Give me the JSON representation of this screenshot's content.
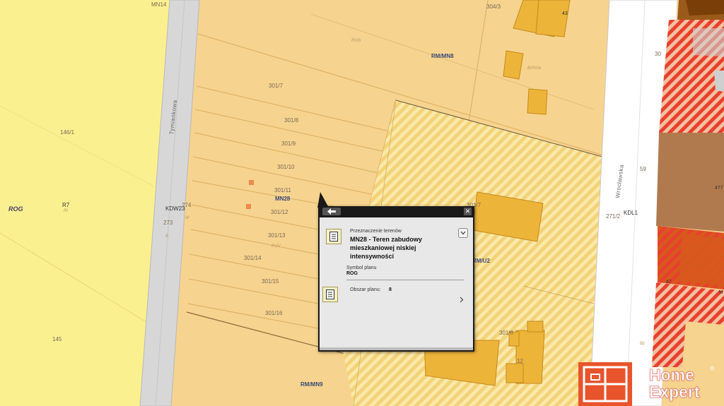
{
  "map": {
    "labels": {
      "mn14": "MN14",
      "p304_3": "304/3",
      "rmmn8": "RM/MN8",
      "rivb": "RIVb",
      "brriva": "BrRIVa",
      "p301_7": "301/7",
      "p301_8": "301/8",
      "p301_9": "301/9",
      "p301_10": "301/10",
      "p301_11": "301/11",
      "mn28": "MN28",
      "p301_12": "301/12",
      "p301_13": "301/13",
      "psiv": "PsIV",
      "p301_14": "301/14",
      "p301_15": "301/15",
      "p301_16": "301/16",
      "p146_1": "146/1",
      "rog": "ROG",
      "r7": "R7",
      "ri": "RI",
      "kdw23": "KDW23",
      "p274": "274",
      "p273": "273",
      "p145": "145",
      "tymiankowa": "Tymiankowa",
      "wroclawska": "Wrocławska",
      "kdl1": "KDL1",
      "p271_2": "271/2",
      "p59": "59",
      "p477": "477",
      "rmu2": "RM/U2",
      "p3017": "301/7",
      "p3016": "301/6",
      "rmmn9": "RM/MN9",
      "p30": "30",
      "p47": "47",
      "p43": "43",
      "m": "M",
      "w": "W",
      "b": "B",
      "bz": "Bz",
      "p12": "12"
    }
  },
  "popup": {
    "back_icon": "arrow-left-icon",
    "close_label": "✕",
    "section1": {
      "caption": "Przeznaczenie terenów",
      "title": "MN28 - Teren zabudowy mieszkaniowej niskiej intensywności",
      "symbol_caption": "Symbol planu",
      "symbol_value": "ROG",
      "expand_icon": "chevron-down-icon"
    },
    "section2": {
      "label": "Obszar planu:",
      "value": "8",
      "next_icon": "chevron-right-icon"
    }
  },
  "logo": {
    "line1": "Home",
    "line2": "Expert",
    "reg": "®"
  },
  "colors": {
    "light_yellow": "#fbf08f",
    "orange_zone": "#f6d38e",
    "road": "#d7d7d7",
    "brown": "#b07a4e",
    "red_hatch": "#e8402e",
    "logo_orange": "#e8542c"
  }
}
